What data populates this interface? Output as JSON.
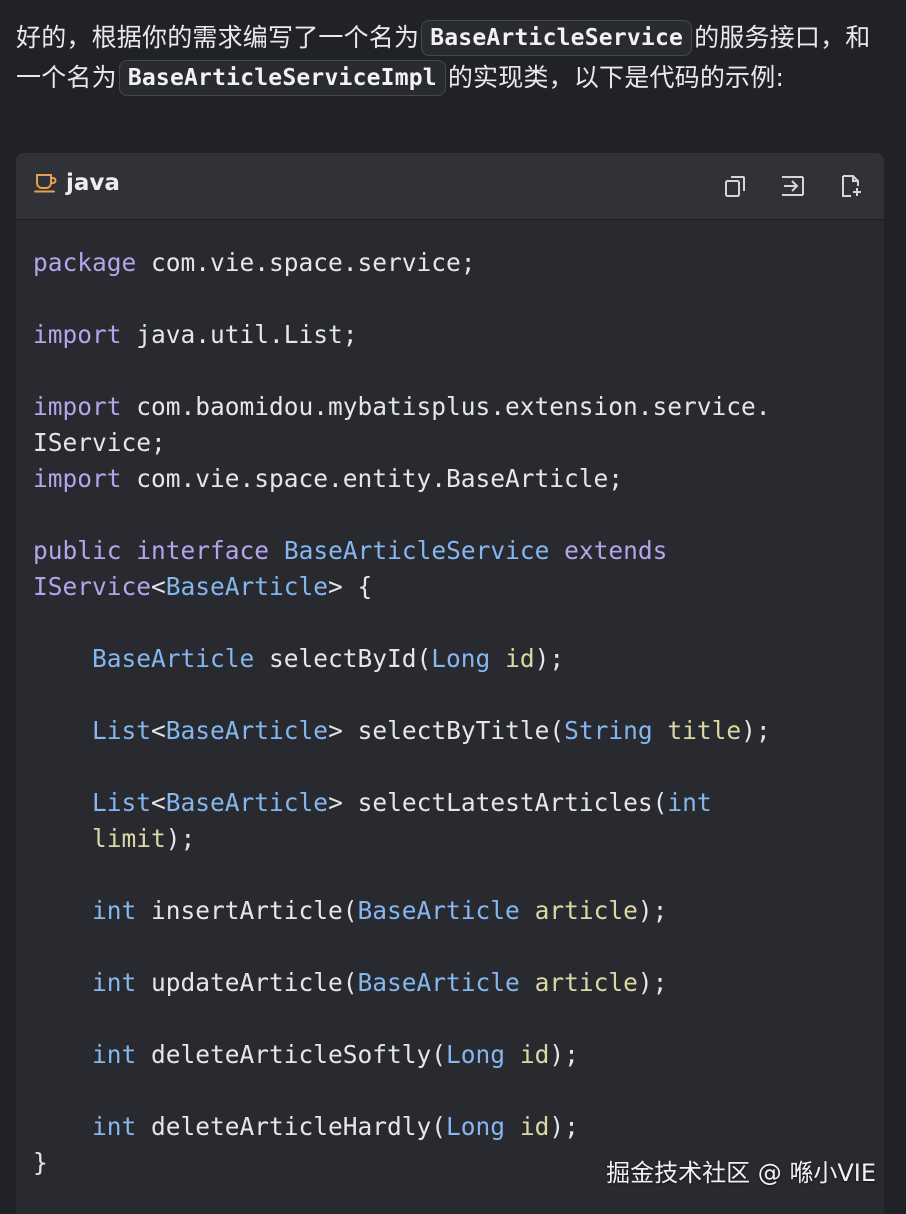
{
  "intro": {
    "part1": "好的，根据你的需求编写了一个名为",
    "service_name": "BaseArticleService",
    "part2": "的服务接口，和一个名为",
    "impl_name": "BaseArticleServiceImpl",
    "part3": "的实现类，以下是代码的示例:"
  },
  "code_block": {
    "language": "java",
    "icons": {
      "language": "coffee-cup-icon",
      "copy": "copy-icon",
      "insert": "insert-at-cursor-icon",
      "new_file": "new-file-icon"
    },
    "lines": [
      [
        {
          "t": "package",
          "c": "kw"
        },
        {
          "t": " com.vie.space.service;",
          "c": ""
        }
      ],
      [],
      [
        {
          "t": "import",
          "c": "kw"
        },
        {
          "t": " java.util.List;",
          "c": ""
        }
      ],
      [],
      [
        {
          "t": "import",
          "c": "kw"
        },
        {
          "t": " com.baomidou.mybatisplus.extension.service.",
          "c": ""
        }
      ],
      [
        {
          "t": "IService;",
          "c": ""
        }
      ],
      [
        {
          "t": "import",
          "c": "kw"
        },
        {
          "t": " com.vie.space.entity.BaseArticle;",
          "c": ""
        }
      ],
      [],
      [
        {
          "t": "public",
          "c": "kw"
        },
        {
          "t": " ",
          "c": ""
        },
        {
          "t": "interface",
          "c": "kw"
        },
        {
          "t": " ",
          "c": ""
        },
        {
          "t": "BaseArticleService",
          "c": "type"
        },
        {
          "t": " ",
          "c": ""
        },
        {
          "t": "extends",
          "c": "kw"
        }
      ],
      [
        {
          "t": "IService",
          "c": "kw"
        },
        {
          "t": "<",
          "c": ""
        },
        {
          "t": "BaseArticle",
          "c": "type"
        },
        {
          "t": "> {",
          "c": ""
        }
      ],
      [],
      [
        {
          "t": "    ",
          "c": ""
        },
        {
          "t": "BaseArticle",
          "c": "type"
        },
        {
          "t": " selectById(",
          "c": ""
        },
        {
          "t": "Long",
          "c": "type"
        },
        {
          "t": " ",
          "c": ""
        },
        {
          "t": "id",
          "c": "param"
        },
        {
          "t": ");",
          "c": ""
        }
      ],
      [],
      [
        {
          "t": "    ",
          "c": ""
        },
        {
          "t": "List",
          "c": "type"
        },
        {
          "t": "<",
          "c": ""
        },
        {
          "t": "BaseArticle",
          "c": "type"
        },
        {
          "t": "> selectByTitle(",
          "c": ""
        },
        {
          "t": "String",
          "c": "type"
        },
        {
          "t": " ",
          "c": ""
        },
        {
          "t": "title",
          "c": "param"
        },
        {
          "t": ");",
          "c": ""
        }
      ],
      [],
      [
        {
          "t": "    ",
          "c": ""
        },
        {
          "t": "List",
          "c": "type"
        },
        {
          "t": "<",
          "c": ""
        },
        {
          "t": "BaseArticle",
          "c": "type"
        },
        {
          "t": "> selectLatestArticles(",
          "c": ""
        },
        {
          "t": "int",
          "c": "type"
        }
      ],
      [
        {
          "t": "    ",
          "c": ""
        },
        {
          "t": "limit",
          "c": "param"
        },
        {
          "t": ");",
          "c": ""
        }
      ],
      [],
      [
        {
          "t": "    ",
          "c": ""
        },
        {
          "t": "int",
          "c": "type"
        },
        {
          "t": " insertArticle(",
          "c": ""
        },
        {
          "t": "BaseArticle",
          "c": "type"
        },
        {
          "t": " ",
          "c": ""
        },
        {
          "t": "article",
          "c": "param"
        },
        {
          "t": ");",
          "c": ""
        }
      ],
      [],
      [
        {
          "t": "    ",
          "c": ""
        },
        {
          "t": "int",
          "c": "type"
        },
        {
          "t": " updateArticle(",
          "c": ""
        },
        {
          "t": "BaseArticle",
          "c": "type"
        },
        {
          "t": " ",
          "c": ""
        },
        {
          "t": "article",
          "c": "param"
        },
        {
          "t": ");",
          "c": ""
        }
      ],
      [],
      [
        {
          "t": "    ",
          "c": ""
        },
        {
          "t": "int",
          "c": "type"
        },
        {
          "t": " deleteArticleSoftly(",
          "c": ""
        },
        {
          "t": "Long",
          "c": "type"
        },
        {
          "t": " ",
          "c": ""
        },
        {
          "t": "id",
          "c": "param"
        },
        {
          "t": ");",
          "c": ""
        }
      ],
      [],
      [
        {
          "t": "    ",
          "c": ""
        },
        {
          "t": "int",
          "c": "type"
        },
        {
          "t": " deleteArticleHardly(",
          "c": ""
        },
        {
          "t": "Long",
          "c": "type"
        },
        {
          "t": " ",
          "c": ""
        },
        {
          "t": "id",
          "c": "param"
        },
        {
          "t": ");",
          "c": ""
        }
      ],
      [
        {
          "t": "}",
          "c": ""
        }
      ]
    ]
  },
  "watermark": "掘金技术社区 @ 喺小VIE",
  "colors": {
    "background": "#212227",
    "code_background": "#282a30",
    "keyword": "#b7a3ea",
    "type": "#86b6ee",
    "parameter": "#dcd8a5",
    "accent_icon": "#e4a24a"
  }
}
